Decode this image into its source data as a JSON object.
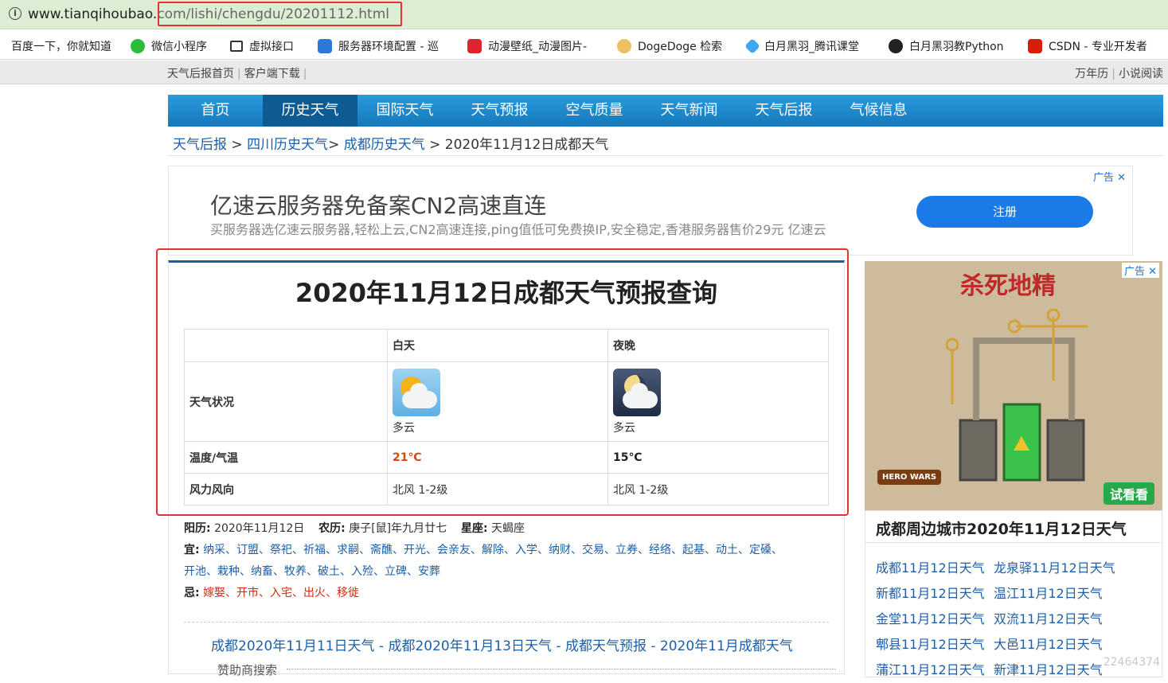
{
  "browser": {
    "url_host": "www.tianqihoubao.",
    "url_path": "com/lishi/chengdu/20201112.html",
    "bookmarks": [
      {
        "label": "百度一下，你就知道",
        "icon": "baidu-icon"
      },
      {
        "label": "微信小程序",
        "icon": "wechat-icon"
      },
      {
        "label": "虚拟接口",
        "icon": "api-icon"
      },
      {
        "label": "服务器环境配置 - 巡",
        "icon": "server-icon"
      },
      {
        "label": "动漫壁纸_动漫图片-",
        "icon": "anime-icon"
      },
      {
        "label": "DogeDoge 检索",
        "icon": "doge-icon"
      },
      {
        "label": "白月黑羽_腾讯课堂",
        "icon": "tencent-icon"
      },
      {
        "label": "白月黑羽教Python",
        "icon": "python-icon"
      },
      {
        "label": "CSDN - 专业开发者",
        "icon": "csdn-icon"
      }
    ]
  },
  "topnav": {
    "left": [
      "天气后报首页",
      "客户端下载"
    ],
    "right": [
      "万年历",
      "小说阅读"
    ]
  },
  "mainnav": [
    {
      "label": "首页",
      "active": false
    },
    {
      "label": "历史天气",
      "active": true
    },
    {
      "label": "国际天气",
      "active": false
    },
    {
      "label": "天气预报",
      "active": false
    },
    {
      "label": "空气质量",
      "active": false
    },
    {
      "label": "天气新闻",
      "active": false
    },
    {
      "label": "天气后报",
      "active": false
    },
    {
      "label": "气候信息",
      "active": false
    }
  ],
  "breadcrumb": {
    "c1": "天气后报",
    "c2": "四川历史天气",
    "c3": "成都历史天气",
    "current": "2020年11月12日成都天气"
  },
  "ad_banner": {
    "tag": "广告",
    "headline": "亿速云服务器免备案CN2高速直连",
    "subtext": "买服务器选亿速云服务器,轻松上云,CN2高速连接,ping值低可免费换IP,安全稳定,香港服务器售价29元 亿速云",
    "button": "注册"
  },
  "weather": {
    "title": "2020年11月12日成都天气预报查询",
    "col_day": "白天",
    "col_night": "夜晚",
    "row_condition": "天气状况",
    "row_temp": "温度/气温",
    "row_wind": "风力风向",
    "day": {
      "condition": "多云",
      "temp": "21℃",
      "wind": "北风 1-2级",
      "icon": "partly-cloudy-day-icon"
    },
    "night": {
      "condition": "多云",
      "temp": "15℃",
      "wind": "北风 1-2级",
      "icon": "partly-cloudy-night-icon"
    }
  },
  "almanac": {
    "solar_label": "阳历:",
    "solar": "2020年11月12日",
    "lunar_label": "农历:",
    "lunar": "庚子[鼠]年九月廿七",
    "zodiac_label": "星座:",
    "zodiac": "天蝎座",
    "yi_label": "宜:",
    "yi_line1": "纳采、订盟、祭祀、祈福、求嗣、斋醮、开光、会亲友、解除、入学、纳财、交易、立券、经络、起基、动土、定磉、",
    "yi_line2": "开池、栽种、纳畜、牧养、破土、入殓、立碑、安葬",
    "ji_label": "忌:",
    "ji": "嫁娶、开市、入宅、出火、移徙"
  },
  "related_links": "成都2020年11月11日天气 - 成都2020年11月13日天气 - 成都天气预报 - 2020年11月成都天气",
  "sponsor": "赞助商搜索",
  "ad_side": {
    "tag": "广告",
    "headline": "杀死地精",
    "button": "试看看",
    "logo": "HERO WARS"
  },
  "nearby": {
    "title": "成都周边城市2020年11月12日天气",
    "items": [
      "成都11月12日天气",
      "龙泉驿11月12日天气",
      "新都11月12日天气",
      "温江11月12日天气",
      "金堂11月12日天气",
      "双流11月12日天气",
      "郫县11月12日天气",
      "大邑11月12日天气",
      "蒲江11月12日天气",
      "新津11月12日天气"
    ]
  },
  "watermark": "22464374"
}
